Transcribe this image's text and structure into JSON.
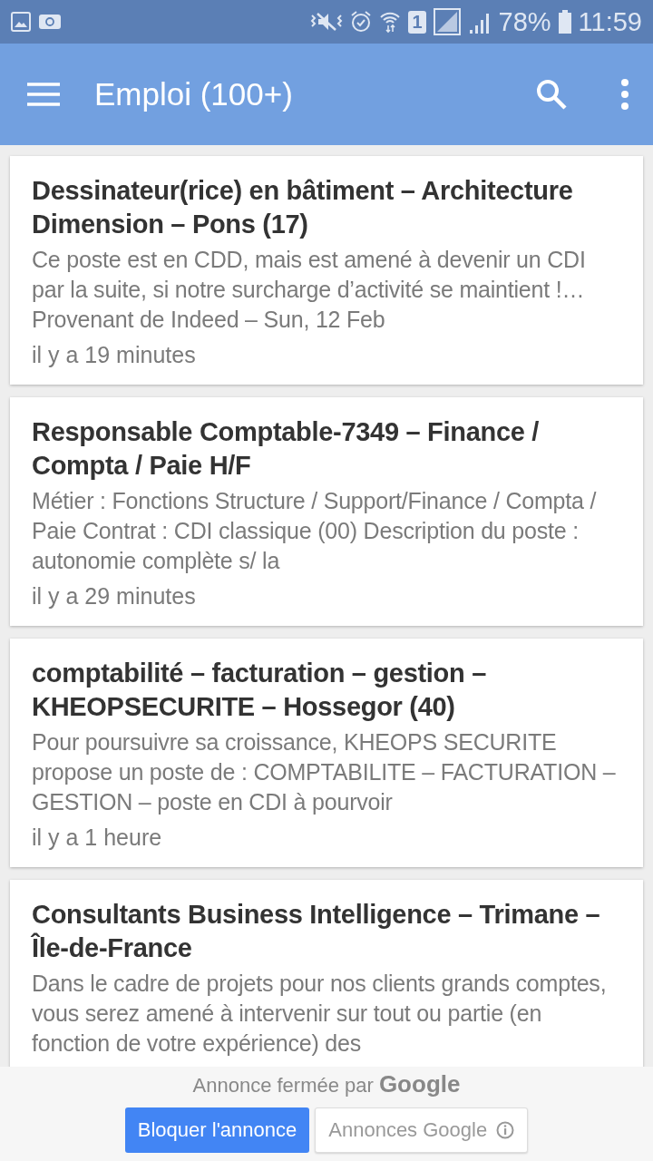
{
  "status_bar": {
    "sim": "1",
    "battery": "78%",
    "time": "11:59"
  },
  "app_bar": {
    "title": "Emploi (100+)"
  },
  "jobs": [
    {
      "title": "Dessinateur(rice) en bâtiment – Architecture Dimension – Pons (17)",
      "snippet": "Ce poste est en CDD, mais est amené à devenir un CDI par la suite, si notre surcharge d’activité se maintient !… Provenant de Indeed – Sun, 12 Feb",
      "age": "il y a 19 minutes"
    },
    {
      "title": "Responsable Comptable-7349 – Finance / Compta / Paie H/F",
      "snippet": "Métier : Fonctions Structure / Support/Finance / Compta / Paie Contrat : CDI classique (00) Description du poste : autonomie complète s/ la",
      "age": "il y a 29 minutes"
    },
    {
      "title": "comptabilité – facturation – gestion – KHEOPSECURITE – Hossegor (40)",
      "snippet": "Pour poursuivre sa croissance, KHEOPS SECURITE propose un poste de : COMPTABILITE – FACTURATION – GESTION – poste en CDI à pourvoir",
      "age": "il y a 1 heure"
    },
    {
      "title": "Consultants Business Intelligence – Trimane – Île-de-France",
      "snippet": "Dans le cadre de projets pour nos clients grands comptes, vous serez amené à intervenir sur tout ou partie (en fonction de votre expérience) des"
    }
  ],
  "ad_bar": {
    "notice": "Annonce fermée par",
    "brand": "Google",
    "buttons": [
      {
        "label": "Bloquer l'annonce",
        "kind": "primary"
      },
      {
        "label": "Annonces Google",
        "kind": "info"
      }
    ]
  }
}
